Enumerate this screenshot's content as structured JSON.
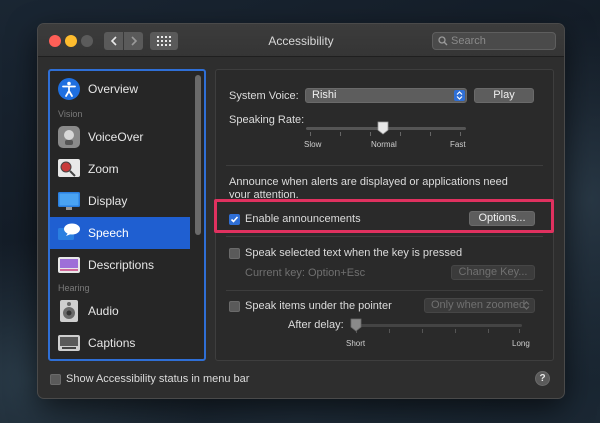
{
  "window": {
    "title": "Accessibility",
    "search_placeholder": "Search"
  },
  "sidebar": {
    "items": [
      {
        "label": "Overview",
        "icon": "accessibility-icon"
      },
      {
        "label": "VoiceOver",
        "icon": "voiceover-icon"
      },
      {
        "label": "Zoom",
        "icon": "zoom-icon"
      },
      {
        "label": "Display",
        "icon": "display-icon"
      },
      {
        "label": "Speech",
        "icon": "speech-icon",
        "selected": true
      },
      {
        "label": "Descriptions",
        "icon": "descriptions-icon"
      },
      {
        "label": "Audio",
        "icon": "audio-icon"
      },
      {
        "label": "Captions",
        "icon": "captions-icon"
      }
    ],
    "sections": {
      "vision": "Vision",
      "hearing": "Hearing"
    }
  },
  "speech": {
    "system_voice_label": "System Voice:",
    "system_voice_value": "Rishi",
    "play_label": "Play",
    "speaking_rate_label": "Speaking Rate:",
    "rate_scale": {
      "slow": "Slow",
      "normal": "Normal",
      "fast": "Fast"
    },
    "announce_text_line1": "Announce when alerts are displayed or applications need",
    "announce_text_line2": "your attention.",
    "enable_announcements_label": "Enable announcements",
    "enable_announcements_checked": true,
    "options_label": "Options...",
    "speak_selected_label": "Speak selected text when the key is pressed",
    "speak_selected_checked": false,
    "current_key_label": "Current key: Option+Esc",
    "change_key_label": "Change Key...",
    "speak_items_label": "Speak items under the pointer",
    "speak_items_checked": false,
    "speak_items_popup_value": "Only when zoomed",
    "after_delay_label": "After delay:",
    "delay_scale": {
      "short": "Short",
      "long": "Long"
    }
  },
  "footer": {
    "show_status_label": "Show Accessibility status in menu bar",
    "show_status_checked": false,
    "help_label": "?"
  },
  "colors": {
    "accent": "#2f6fd6",
    "highlight": "#e0315f"
  }
}
